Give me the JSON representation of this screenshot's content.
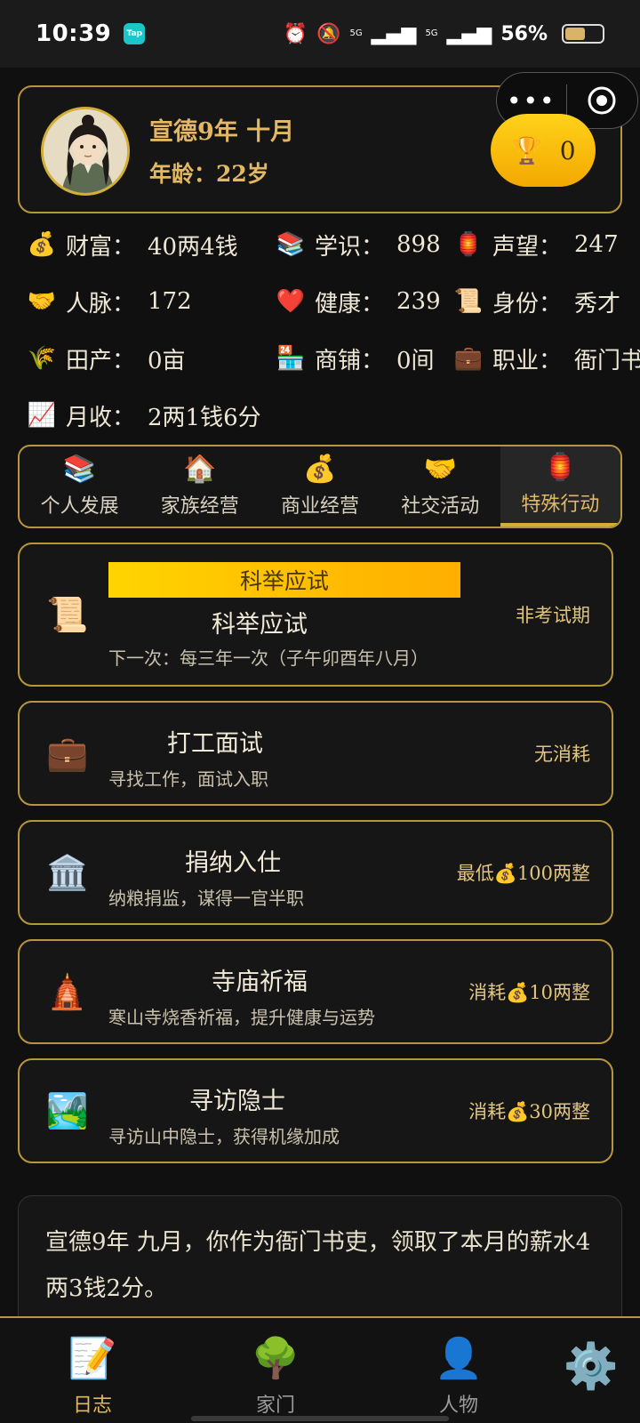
{
  "status": {
    "time": "10:39",
    "app_badge": "Tap",
    "signal1": "5G",
    "signal2": "5G",
    "battery": "56%",
    "battery_level": 0.56
  },
  "profile": {
    "date": "宣德9年 十月",
    "age_label": "年龄：",
    "age_value": "22岁",
    "trophy_count": "0"
  },
  "stats": [
    {
      "icon": "money-bag-icon",
      "glyph": "💰",
      "label": "财富：",
      "value": "40两4钱"
    },
    {
      "icon": "books-icon",
      "glyph": "📚",
      "label": "学识：",
      "value": "898"
    },
    {
      "icon": "lantern-icon",
      "glyph": "🏮",
      "label": "声望：",
      "value": "247"
    },
    {
      "icon": "handshake-icon",
      "glyph": "🤝",
      "label": "人脉：",
      "value": "172"
    },
    {
      "icon": "heart-icon",
      "glyph": "❤️",
      "label": "健康：",
      "value": "239"
    },
    {
      "icon": "scroll-icon",
      "glyph": "📜",
      "label": "身份：",
      "value": "秀才"
    },
    {
      "icon": "wheat-icon",
      "glyph": "🌾",
      "label": "田产：",
      "value": "0亩"
    },
    {
      "icon": "shop-icon",
      "glyph": "🏪",
      "label": "商铺：",
      "value": "0间"
    },
    {
      "icon": "briefcase-icon",
      "glyph": "💼",
      "label": "职业：",
      "value": "衙门书吏"
    },
    {
      "icon": "chart-up-icon",
      "glyph": "📈",
      "label": "月收：",
      "value": "2两1钱6分"
    }
  ],
  "tabs": [
    {
      "glyph": "📚",
      "label": "个人发展",
      "active": false
    },
    {
      "glyph": "🏠",
      "label": "家族经营",
      "active": false
    },
    {
      "glyph": "💰",
      "label": "商业经营",
      "active": false
    },
    {
      "glyph": "🤝",
      "label": "社交活动",
      "active": false
    },
    {
      "glyph": "🏮",
      "label": "特殊行动",
      "active": true
    }
  ],
  "actions": [
    {
      "glyph": "📜",
      "banner": "科举应试",
      "title": "科举应试",
      "sub": "下一次：每三年一次（子午卯酉年八月）",
      "right": "非考试期"
    },
    {
      "glyph": "💼",
      "title": "打工面试",
      "sub": "寻找工作，面试入职",
      "right": "无消耗"
    },
    {
      "glyph": "🏛️",
      "title": "捐纳入仕",
      "sub": "纳粮捐监，谋得一官半职",
      "right": "最低💰100两整"
    },
    {
      "glyph": "🛕",
      "title": "寺庙祈福",
      "sub": "寒山寺烧香祈福，提升健康与运势",
      "right": "消耗💰10两整"
    },
    {
      "glyph": "🏞️",
      "title": "寻访隐士",
      "sub": "寻访山中隐士，获得机缘加成",
      "right": "消耗💰30两整"
    }
  ],
  "log": {
    "text": "宣德9年 九月，你作为衙门书吏，领取了本月的薪水4两3钱2分。"
  },
  "nav": [
    {
      "glyph": "📝",
      "label": "日志",
      "active": true
    },
    {
      "glyph": "🌳",
      "label": "家门",
      "active": false
    },
    {
      "glyph": "👤",
      "label": "人物",
      "active": false
    },
    {
      "glyph": "⚙️",
      "label": "",
      "active": false
    }
  ]
}
